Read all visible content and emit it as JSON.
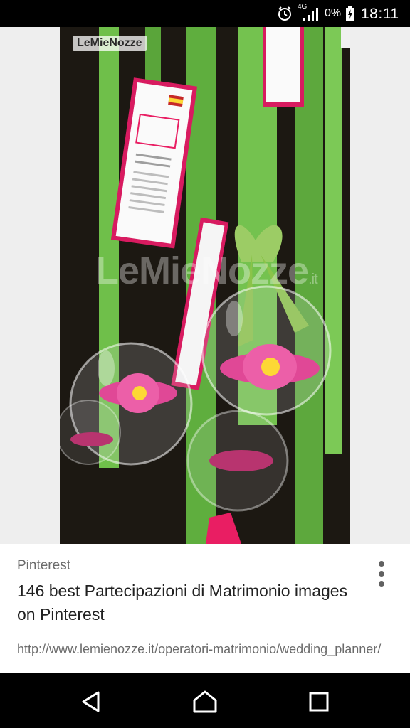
{
  "status_bar": {
    "network": "4G",
    "battery": "0%",
    "time": "18:11",
    "icons": [
      "alarm-clock-icon",
      "signal-icon",
      "battery-charging-icon"
    ]
  },
  "image": {
    "watermark_top": "LeMieNozze",
    "watermark_center": "LeMieNozze",
    "watermark_center_tld": ".it"
  },
  "result": {
    "source": "Pinterest",
    "title": "146 best Partecipazioni di Matrimonio images on Pinterest",
    "url": "http://www.lemienozze.it/operatori-matrimonio/wedding_planner/"
  },
  "nav": {
    "icons": [
      "back-icon",
      "home-icon",
      "recents-icon"
    ]
  }
}
